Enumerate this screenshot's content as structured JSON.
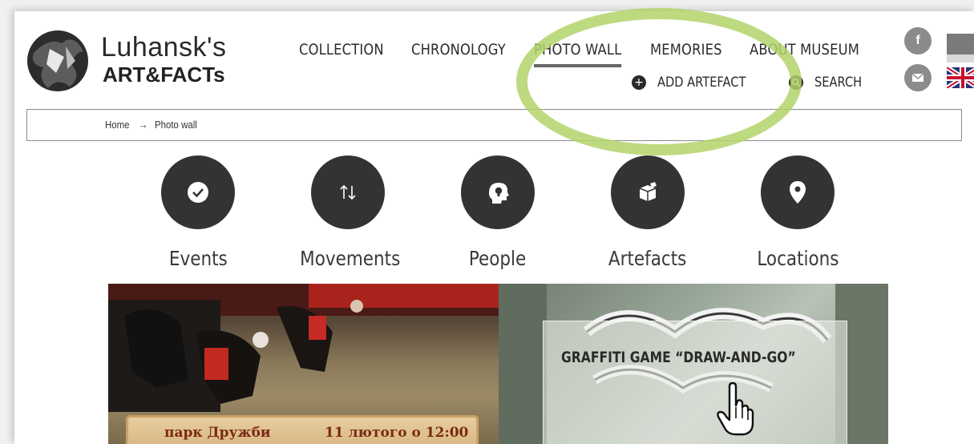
{
  "brand": {
    "line1": "Luhansk's",
    "line2": "ART&FACTs"
  },
  "nav": {
    "items": [
      {
        "label": "COLLECTION"
      },
      {
        "label": "CHRONOLOGY"
      },
      {
        "label": "PHOTO WALL",
        "active": true
      },
      {
        "label": "MEMORIES"
      },
      {
        "label": "ABOUT MUSEUM"
      }
    ],
    "add_artefact": "ADD ARTEFACT",
    "search": "SEARCH"
  },
  "social": {
    "facebook": "f",
    "email_icon": "envelope-icon"
  },
  "breadcrumb": {
    "home": "Home",
    "separator": "→",
    "current": "Photo wall"
  },
  "categories": [
    {
      "label": "Events",
      "icon": "check-icon"
    },
    {
      "label": "Movements",
      "icon": "up-down-arrows-icon"
    },
    {
      "label": "People",
      "icon": "head-lightbulb-icon"
    },
    {
      "label": "Artefacts",
      "icon": "box-icon"
    },
    {
      "label": "Locations",
      "icon": "map-pin-icon"
    }
  ],
  "photos": {
    "left": {
      "scroll_left": "парк Дружби",
      "scroll_right": "11 лютого о 12:00"
    },
    "right": {
      "title": "GRAFFITI GAME “DRAW-AND-GO”"
    }
  },
  "colors": {
    "highlight": "#b3d36a",
    "circle": "#333333",
    "social": "#8b8b8b"
  }
}
